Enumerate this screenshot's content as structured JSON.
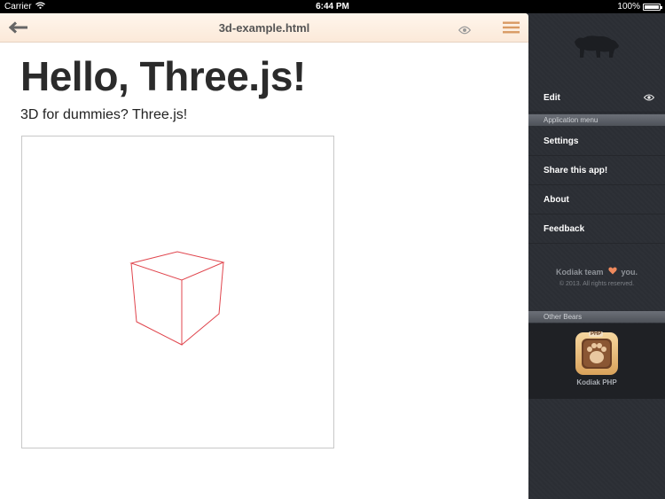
{
  "status": {
    "carrier": "Carrier",
    "time": "6:44 PM",
    "battery": "100%"
  },
  "nav": {
    "title": "3d-example.html"
  },
  "page": {
    "heading": "Hello, Three.js!",
    "subtitle": "3D for dummies? Three.js!"
  },
  "sidebar": {
    "edit_label": "Edit",
    "section_app_menu": "Application menu",
    "items": [
      {
        "label": "Settings"
      },
      {
        "label": "Share this app!"
      },
      {
        "label": "About"
      },
      {
        "label": "Feedback"
      }
    ],
    "credits_team": "Kodiak team",
    "credits_you": "you.",
    "credits_copy": "© 2013. All rights reserved.",
    "section_other_bears": "Other Bears",
    "app_name": "Kodiak PHP",
    "app_badge": "PHP"
  },
  "colors": {
    "cube_stroke": "#e0444c",
    "heart": "#f08a5d",
    "nav_bg": "#fbe9d9"
  },
  "icons": {
    "back": "arrow-left-icon",
    "preview": "eye-icon",
    "menu": "hamburger-icon",
    "logo": "bear-icon",
    "heart": "heart-icon"
  }
}
